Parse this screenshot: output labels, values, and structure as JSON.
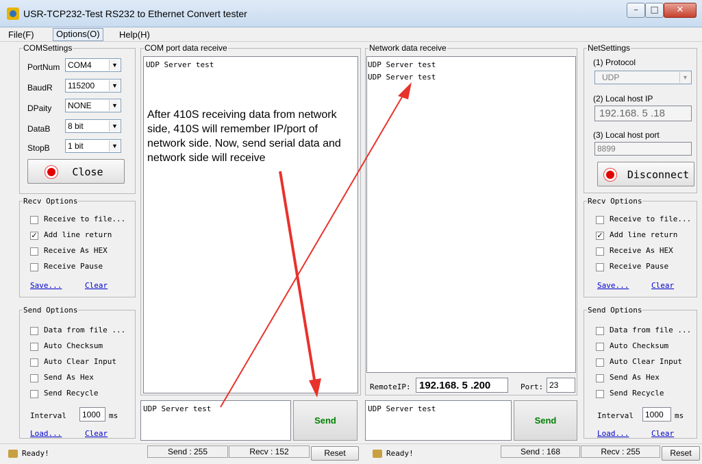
{
  "window": {
    "title": "USR-TCP232-Test  RS232 to Ethernet Convert tester"
  },
  "menu": [
    "File(F)",
    "Options(O)",
    "Help(H)"
  ],
  "com_settings": {
    "legend": "COMSettings",
    "rows": [
      {
        "label": "PortNum",
        "value": "COM4"
      },
      {
        "label": "BaudR",
        "value": "115200"
      },
      {
        "label": "DPaity",
        "value": "NONE"
      },
      {
        "label": "DataB",
        "value": "8 bit"
      },
      {
        "label": "StopB",
        "value": "1 bit"
      }
    ],
    "close_button": "Close"
  },
  "net_settings": {
    "legend": "NetSettings",
    "protocol_label": "(1) Protocol",
    "protocol_value": "UDP",
    "local_ip_label": "(2) Local host IP",
    "local_ip_value": "192.168. 5 .18",
    "local_port_label": "(3) Local host port",
    "local_port_value": "8899",
    "disconnect_button": "Disconnect"
  },
  "recv_options": {
    "legend": "Recv Options",
    "items": [
      {
        "label": "Receive to file...",
        "checked": false
      },
      {
        "label": "Add line return",
        "checked": true
      },
      {
        "label": "Receive As HEX",
        "checked": false
      },
      {
        "label": "Receive Pause",
        "checked": false
      }
    ],
    "save_link": "Save...",
    "clear_link": "Clear"
  },
  "send_options": {
    "legend": "Send Options",
    "items": [
      {
        "label": "Data from file ...",
        "checked": false
      },
      {
        "label": "Auto Checksum",
        "checked": false
      },
      {
        "label": "Auto Clear Input",
        "checked": false
      },
      {
        "label": "Send As Hex",
        "checked": false
      },
      {
        "label": "Send Recycle",
        "checked": false
      }
    ],
    "interval_label": "Interval",
    "interval_value": "1000",
    "interval_unit": "ms",
    "load_link": "Load...",
    "clear_link": "Clear"
  },
  "com_receive": {
    "legend": "COM port data receive",
    "lines": [
      "UDP Server test"
    ],
    "annotation": "After 410S receiving data from network side, 410S will remember IP/port of network side. Now, send serial data and network side will receive"
  },
  "net_receive": {
    "legend": "Network data receive",
    "lines": [
      "UDP Server test",
      "UDP Server test"
    ]
  },
  "remote": {
    "ip_label": "RemoteIP:",
    "ip_value": "192.168. 5 .200",
    "port_label": "Port:",
    "port_value": "23"
  },
  "com_send": {
    "text": "UDP Server test",
    "button": "Send"
  },
  "net_send": {
    "text": "UDP Server test",
    "button": "Send"
  },
  "status_left": {
    "ready": "Ready!",
    "send": "Send : 255",
    "recv": "Recv : 152",
    "reset": "Reset"
  },
  "status_right": {
    "ready": "Ready!",
    "send": "Send : 168",
    "recv": "Recv : 255",
    "reset": "Reset"
  },
  "colors": {
    "arrow": "#e8322c",
    "send_text": "#008000",
    "link": "#0000cc",
    "indicator": "#e10000"
  }
}
